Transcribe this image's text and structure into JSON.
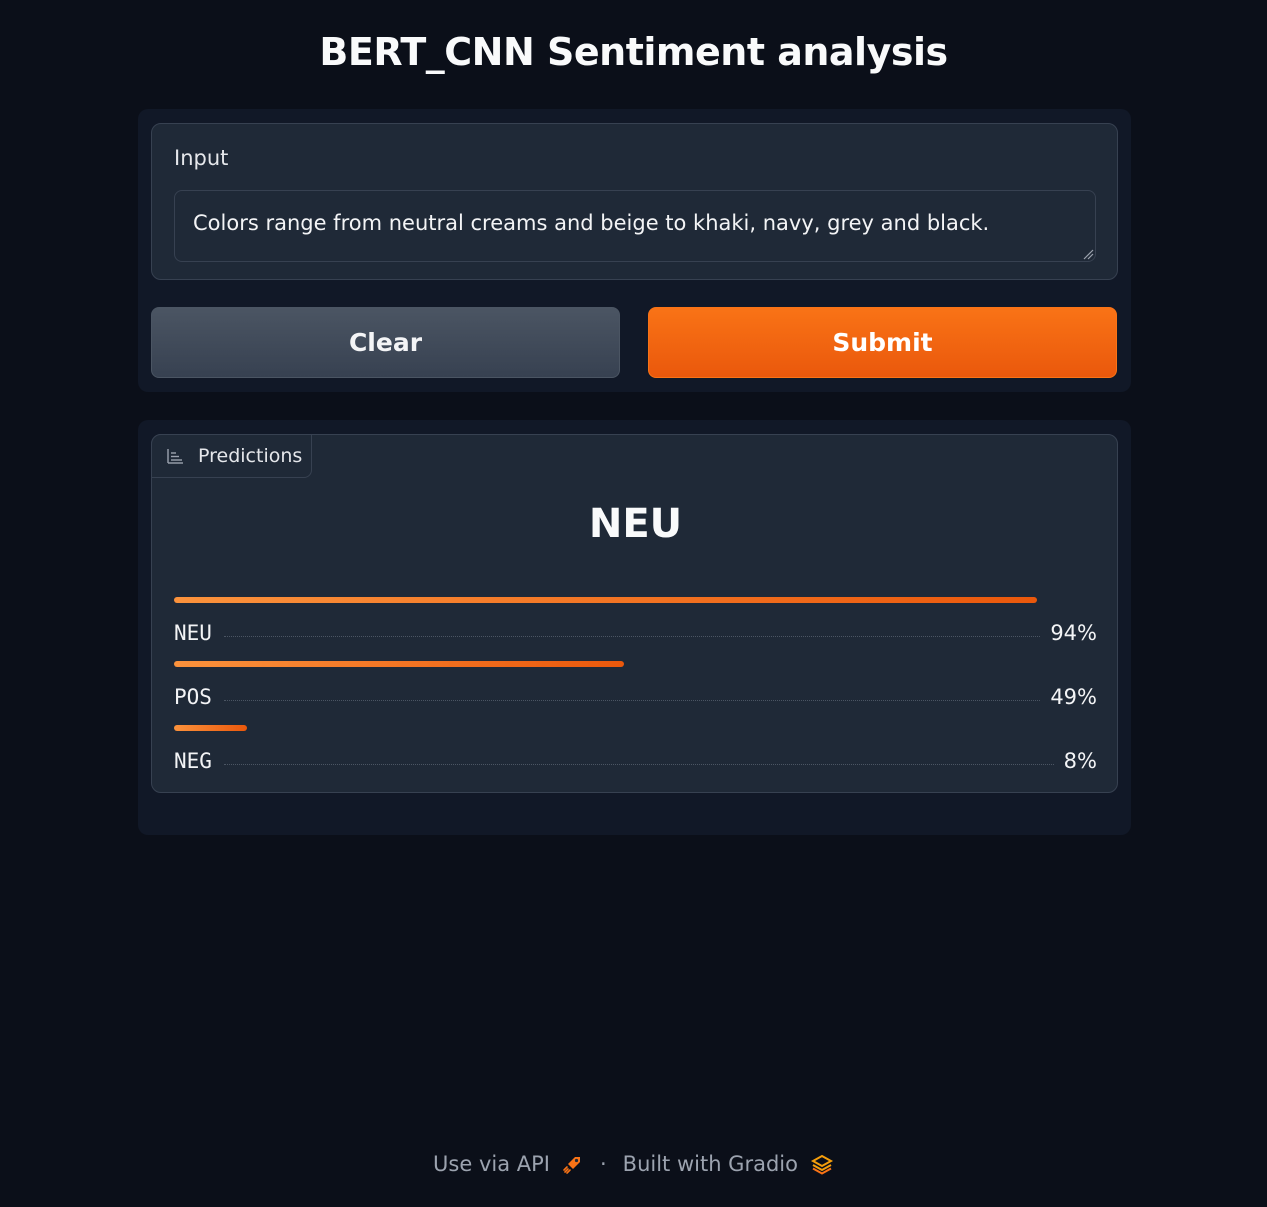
{
  "app": {
    "title": "BERT_CNN Sentiment analysis"
  },
  "input": {
    "label": "Input",
    "value": "Colors range from neutral creams and beige to khaki, navy, grey and black."
  },
  "buttons": {
    "clear_label": "Clear",
    "submit_label": "Submit"
  },
  "output": {
    "tab_label": "Predictions",
    "top_label": "NEU",
    "predictions": [
      {
        "label": "NEU",
        "percent": "94%",
        "fraction": 0.94
      },
      {
        "label": "POS",
        "percent": "49%",
        "fraction": 0.49
      },
      {
        "label": "NEG",
        "percent": "8%",
        "fraction": 0.08
      }
    ]
  },
  "footer": {
    "api_label": "Use via API",
    "separator": "·",
    "built_label": "Built with Gradio"
  },
  "colors": {
    "background": "#0b0f19",
    "panel": "#111827",
    "block": "#1f2937",
    "accent": "#f97316",
    "accent_dark": "#ea580c"
  },
  "icons": {
    "output_tab": "bar-chart-icon",
    "api": "rocket-icon",
    "gradio": "gradio-logo-icon"
  }
}
